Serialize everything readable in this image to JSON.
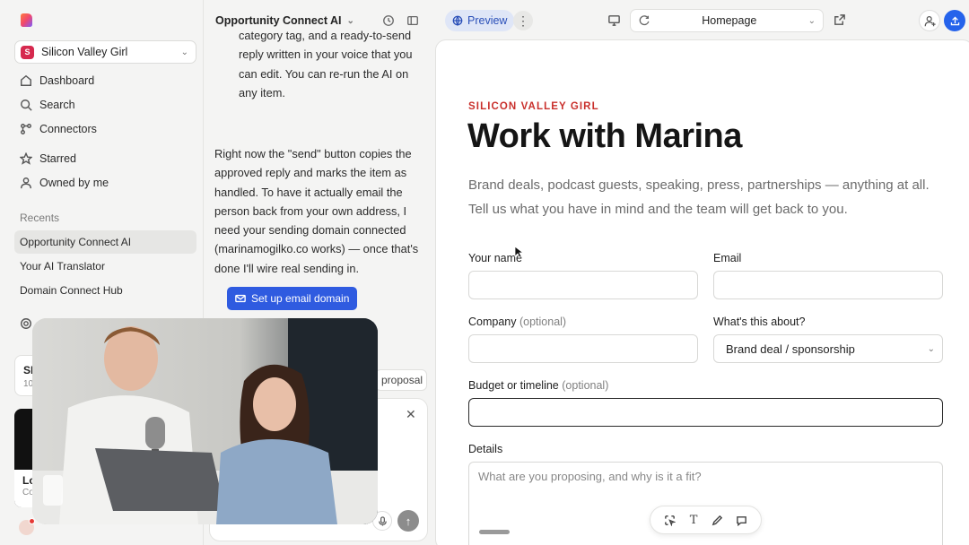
{
  "sidebar": {
    "workspace": {
      "initial": "S",
      "name": "Silicon Valley Girl"
    },
    "nav": [
      {
        "label": "Dashboard",
        "icon": "home-icon"
      },
      {
        "label": "Search",
        "icon": "search-icon"
      },
      {
        "label": "Connectors",
        "icon": "connectors-icon"
      },
      {
        "label": "Starred",
        "icon": "star-icon"
      },
      {
        "label": "Owned by me",
        "icon": "user-icon"
      }
    ],
    "recents_label": "Recents",
    "recents": [
      {
        "label": "Opportunity Connect AI",
        "active": true
      },
      {
        "label": "Your AI Translator",
        "active": false
      },
      {
        "label": "Domain Connect Hub",
        "active": false
      }
    ],
    "partial": {
      "settings": "S",
      "card_a_title": "SI",
      "card_a_sub": "10",
      "card_b_title": "Lo",
      "card_b_sub": "Co"
    }
  },
  "chat": {
    "title": "Opportunity Connect AI",
    "message_1": "category tag, and a ready-to-send reply written in your voice that you can edit. You can re-run the AI on any item.",
    "message_2": "Right now the \"send\" button copies the approved reply and marks the item as handled. To have it actually email the person back from your own address, I need your sending domain connected (marinamogilko.co works) — once that's done I'll wire real sending in.",
    "email_button": "Set up email domain",
    "chip": "proposal"
  },
  "toolbar": {
    "preview_label": "Preview",
    "page_select": "Homepage"
  },
  "preview": {
    "eyebrow": "SILICON VALLEY GIRL",
    "headline": "Work with Marina",
    "lede": "Brand deals, podcast guests, speaking, press, partnerships — anything at all. Tell us what you have in mind and the team will get back to you.",
    "form": {
      "name_label": "Your name",
      "email_label": "Email",
      "company_label": "Company",
      "optional": "(optional)",
      "about_label": "What's this about?",
      "about_value": "Brand deal / sponsorship",
      "budget_label": "Budget or timeline",
      "details_label": "Details",
      "details_placeholder": "What are you proposing, and why is it a fit?"
    }
  },
  "colors": {
    "accent": "#2f5be0",
    "eyebrow": "#c9302c",
    "brand_badge": "#d6294e"
  }
}
